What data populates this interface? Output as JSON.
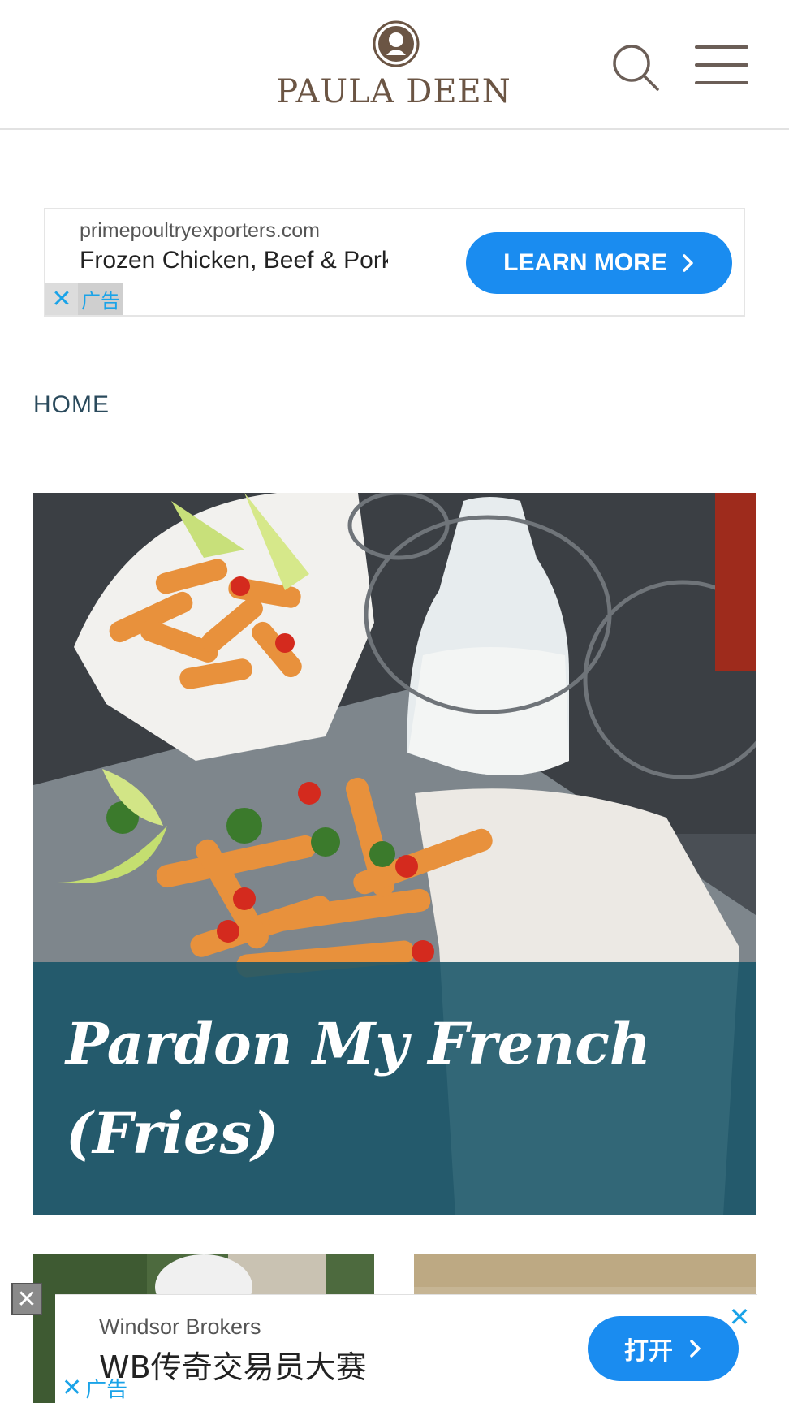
{
  "header": {
    "logo_text": "PAULA DEEN",
    "search_icon": "search-icon",
    "menu_icon": "hamburger-menu-icon"
  },
  "ad_top": {
    "domain": "primepoultryexporters.com",
    "headline": "Frozen Chicken, Beef & Pork",
    "cta_label": "LEARN MORE",
    "adchoices_label": "广告",
    "accent": "#1a8cf0"
  },
  "breadcrumb": {
    "home": "HOME"
  },
  "hero": {
    "title": "Pardon My French (Fries)",
    "caption_color": "#185468"
  },
  "ad_bottom": {
    "brand": "Windsor Brokers",
    "headline": "WB传奇交易员大赛",
    "cta_label": "打开",
    "adchoices_label": "广告",
    "accent": "#1a8cf0"
  }
}
